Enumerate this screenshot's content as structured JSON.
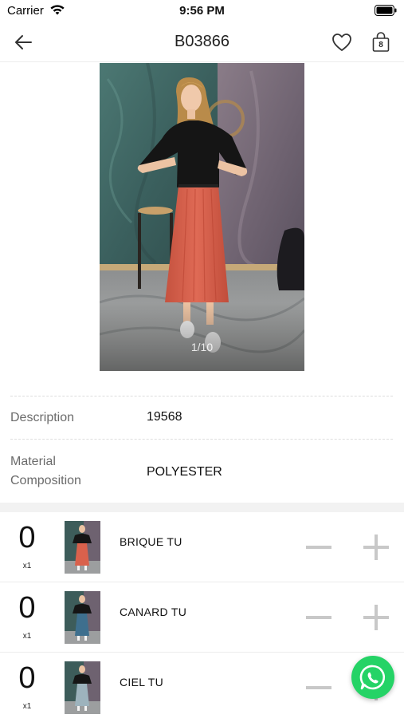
{
  "status_bar": {
    "carrier": "Carrier",
    "time": "9:56 PM",
    "wifi_icon": "wifi-icon",
    "battery_icon": "battery-full-icon"
  },
  "nav": {
    "title": "B03866",
    "back_icon": "arrow-left-icon",
    "favorite_icon": "heart-icon",
    "cart_icon": "shopping-bag-icon",
    "cart_count": "8"
  },
  "gallery": {
    "counter": "1/10",
    "current_index": 1,
    "total": 10
  },
  "specs": [
    {
      "label": "Description",
      "value": "19568"
    },
    {
      "label": "Material Composition",
      "value": "POLYESTER"
    }
  ],
  "variants": [
    {
      "quantity": "0",
      "multiplier": "x1",
      "name": "BRIQUE TU",
      "skirt_color": "#d9614c"
    },
    {
      "quantity": "0",
      "multiplier": "x1",
      "name": "CANARD TU",
      "skirt_color": "#3e6f8e"
    },
    {
      "quantity": "0",
      "multiplier": "x1",
      "name": "CIEL TU",
      "skirt_color": "#9db3bd"
    }
  ],
  "actions": {
    "minus_icon": "minus-icon",
    "plus_icon": "plus-icon",
    "whatsapp_icon": "whatsapp-icon"
  },
  "colors": {
    "whatsapp": "#25d366",
    "control_grey": "#c8c8c8",
    "skirt_main": "#d9614c"
  }
}
